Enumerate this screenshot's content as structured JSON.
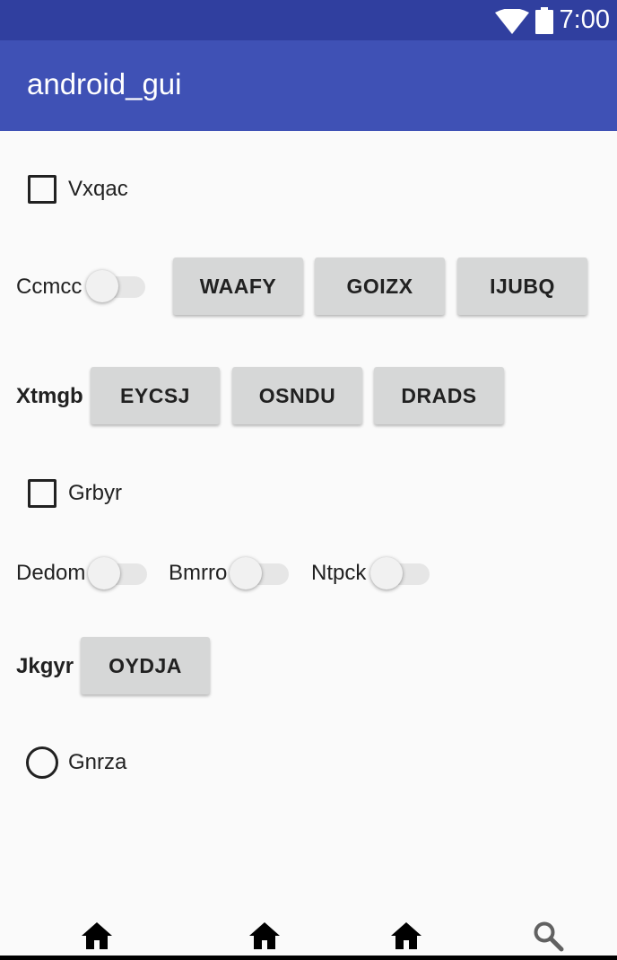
{
  "status_bar": {
    "time": "7:00"
  },
  "app_bar": {
    "title": "android_gui"
  },
  "checkboxes": [
    {
      "label": "Vxqac",
      "checked": false
    },
    {
      "label": "Grbyr",
      "checked": false
    }
  ],
  "row_ccmcc": {
    "switch_label": "Ccmcc",
    "switch_on": false,
    "buttons": [
      "WAAFY",
      "GOIZX",
      "IJUBQ"
    ]
  },
  "row_xtmgb": {
    "label": "Xtmgb",
    "buttons": [
      "EYCSJ",
      "OSNDU",
      "DRADS"
    ]
  },
  "switch_row": [
    {
      "label": "Dedom",
      "on": false
    },
    {
      "label": "Bmrro",
      "on": false
    },
    {
      "label": "Ntpck",
      "on": false
    }
  ],
  "row_jkgyr": {
    "label": "Jkgyr",
    "buttons": [
      "OYDJA"
    ]
  },
  "radio": {
    "label": "Gnrza",
    "selected": false
  },
  "bottom_nav": {
    "items": [
      {
        "icon": "home-icon"
      },
      {
        "icon": "home-icon"
      },
      {
        "icon": "home-icon"
      },
      {
        "icon": "search-icon"
      }
    ]
  },
  "colors": {
    "status_bar": "#303f9f",
    "app_bar": "#3f51b5",
    "background": "#fafafa",
    "button": "#d6d7d7"
  }
}
